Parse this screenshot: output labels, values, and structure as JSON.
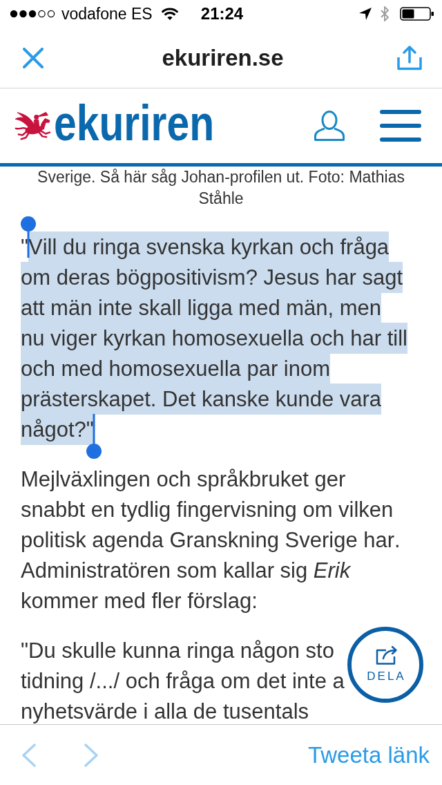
{
  "status_bar": {
    "carrier": "vodafone ES",
    "time": "21:24"
  },
  "nav_bar": {
    "title": "ekuriren.se"
  },
  "site_header": {
    "logo_text": "ekuriren"
  },
  "article": {
    "caption": "Sverige. Så här såg Johan-profilen ut. Foto: Mathias Ståhle",
    "paragraphs": [
      {
        "kind": "quote",
        "segments": [
          {
            "text": "\"",
            "selected": false
          },
          {
            "text": "Vill du ringa svenska kyrkan och fråga om deras bögpositivism? Jesus har sagt att män inte skall ligga med män, men nu viger kyrkan homosexuella och har till och med homosexuella par inom prästerskapet. Det kanske kunde vara något?\"",
            "selected": true
          }
        ]
      },
      {
        "kind": "text",
        "text": "Mejlväxlingen och språkbruket ger snabbt en tydlig fingervisning om vilken politisk agenda Granskning Sverige har. Administratören som kallar sig *Erik* kommer med fler förslag:"
      },
      {
        "kind": "lines",
        "lines": [
          "\"Du skulle kunna ringa någon sto",
          "tidning /.../ och fråga om det inte a",
          "nyhetsvärde i alla de tusentals"
        ]
      }
    ]
  },
  "share_button": {
    "label": "DELA"
  },
  "toolbar": {
    "back": {
      "disabled": true
    },
    "forward": {
      "disabled": true
    },
    "tweet_link": "Tweeta länk"
  }
}
